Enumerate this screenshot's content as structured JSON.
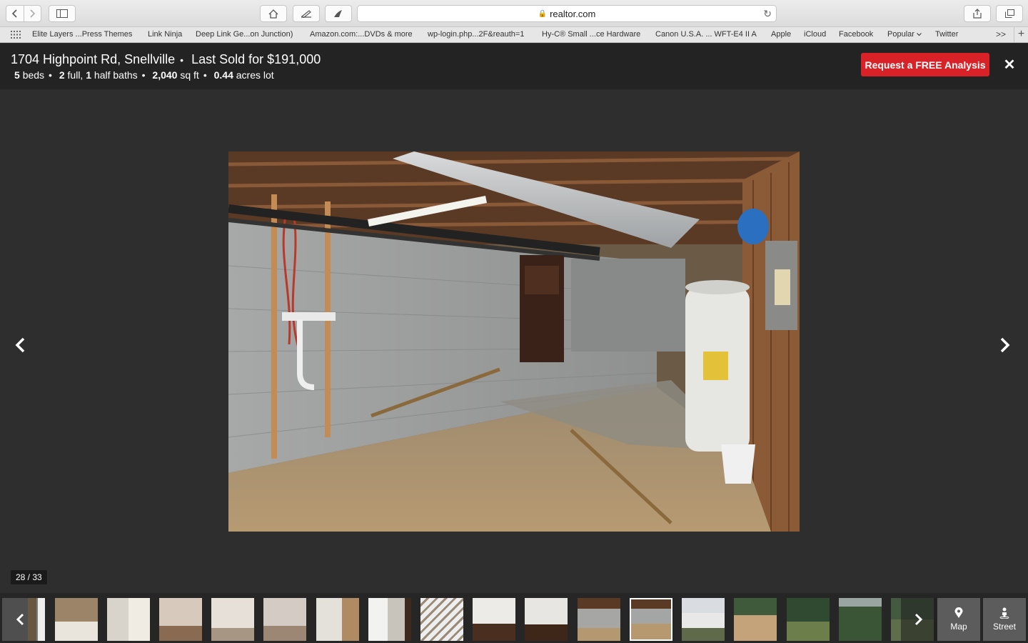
{
  "browser": {
    "url": "realtor.com",
    "bookmarks": [
      "Elite Layers ...Press Themes",
      "Link Ninja",
      "Deep Link Ge...on Junction)",
      "Amazon.com:...DVDs & more",
      "wp-login.php...2F&reauth=1",
      "Hy-C® Small ...ce Hardware",
      "Canon U.S.A. ... WFT-E4 II A",
      "Apple",
      "iCloud",
      "Facebook",
      "Popular",
      "Twitter"
    ],
    "more_label": ">>",
    "add_label": "+"
  },
  "listing": {
    "address": "1704 Highpoint Rd, Snellville",
    "sold": "Last Sold for $191,000",
    "beds_num": "5",
    "beds_label": "beds",
    "full_num": "2",
    "full_label": "full,",
    "half_num": "1",
    "half_label": "half baths",
    "sqft_num": "2,040",
    "sqft_label": "sq ft",
    "lot_num": "0.44",
    "lot_label": "acres lot",
    "separator": "•"
  },
  "cta": {
    "label": "Request a FREE Analysis"
  },
  "close_label": "✕",
  "viewer": {
    "counter": "28 / 33"
  },
  "filmstrip": {
    "map_label": "Map",
    "street_label": "Street"
  }
}
